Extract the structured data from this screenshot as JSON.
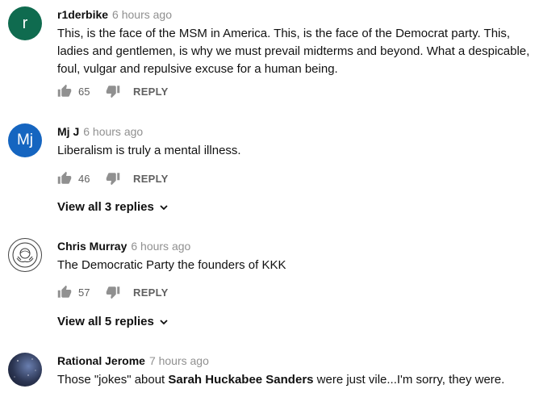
{
  "comments": [
    {
      "avatar_letter": "r",
      "avatar_color": "#0f6b4f",
      "author": "r1derbike",
      "time": "6 hours ago",
      "text": "This, is the face of the MSM in America.  This, is the face of the Democrat party.  This, ladies and gentlemen, is why we must prevail midterms and beyond.  What a despicable, foul, vulgar and repulsive excuse for a human being.",
      "likes": "65",
      "reply_label": "REPLY"
    },
    {
      "avatar_letter": "Mj",
      "avatar_color": "#1565c0",
      "author": "Mj J",
      "time": "6 hours ago",
      "text": "Liberalism is truly a mental illness.",
      "likes": "46",
      "reply_label": "REPLY",
      "view_replies": "View all 3 replies"
    },
    {
      "author": "Chris Murray",
      "time": "6 hours ago",
      "text": "The Democratic Party the founders of KKK",
      "likes": "57",
      "reply_label": "REPLY",
      "view_replies": "View all 5 replies"
    },
    {
      "author": "Rational Jerome",
      "time": "7 hours ago",
      "text_before": "Those \"jokes\" about ",
      "text_bold": "Sarah Huckabee Sanders",
      "text_after": " were just vile...I'm sorry, they were."
    }
  ]
}
